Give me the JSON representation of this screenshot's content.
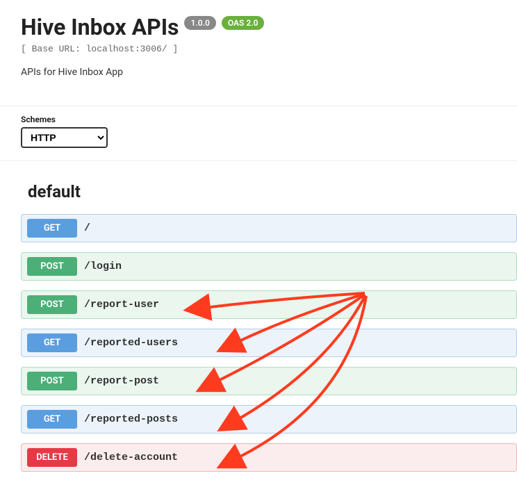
{
  "header": {
    "title": "Hive Inbox APIs",
    "version": "1.0.0",
    "oas": "OAS 2.0",
    "base_url": "[ Base URL: localhost:3006/ ]",
    "description": "APIs for Hive Inbox App"
  },
  "schemes": {
    "label": "Schemes",
    "selected": "HTTP"
  },
  "section": "default",
  "operations": [
    {
      "method": "GET",
      "path": "/"
    },
    {
      "method": "POST",
      "path": "/login"
    },
    {
      "method": "POST",
      "path": "/report-user"
    },
    {
      "method": "GET",
      "path": "/reported-users"
    },
    {
      "method": "POST",
      "path": "/report-post"
    },
    {
      "method": "GET",
      "path": "/reported-posts"
    },
    {
      "method": "DELETE",
      "path": "/delete-account"
    }
  ],
  "colors": {
    "get": "#5a9ee0",
    "post": "#4caf77",
    "delete": "#e63946",
    "arrow": "#ff3b1f"
  }
}
